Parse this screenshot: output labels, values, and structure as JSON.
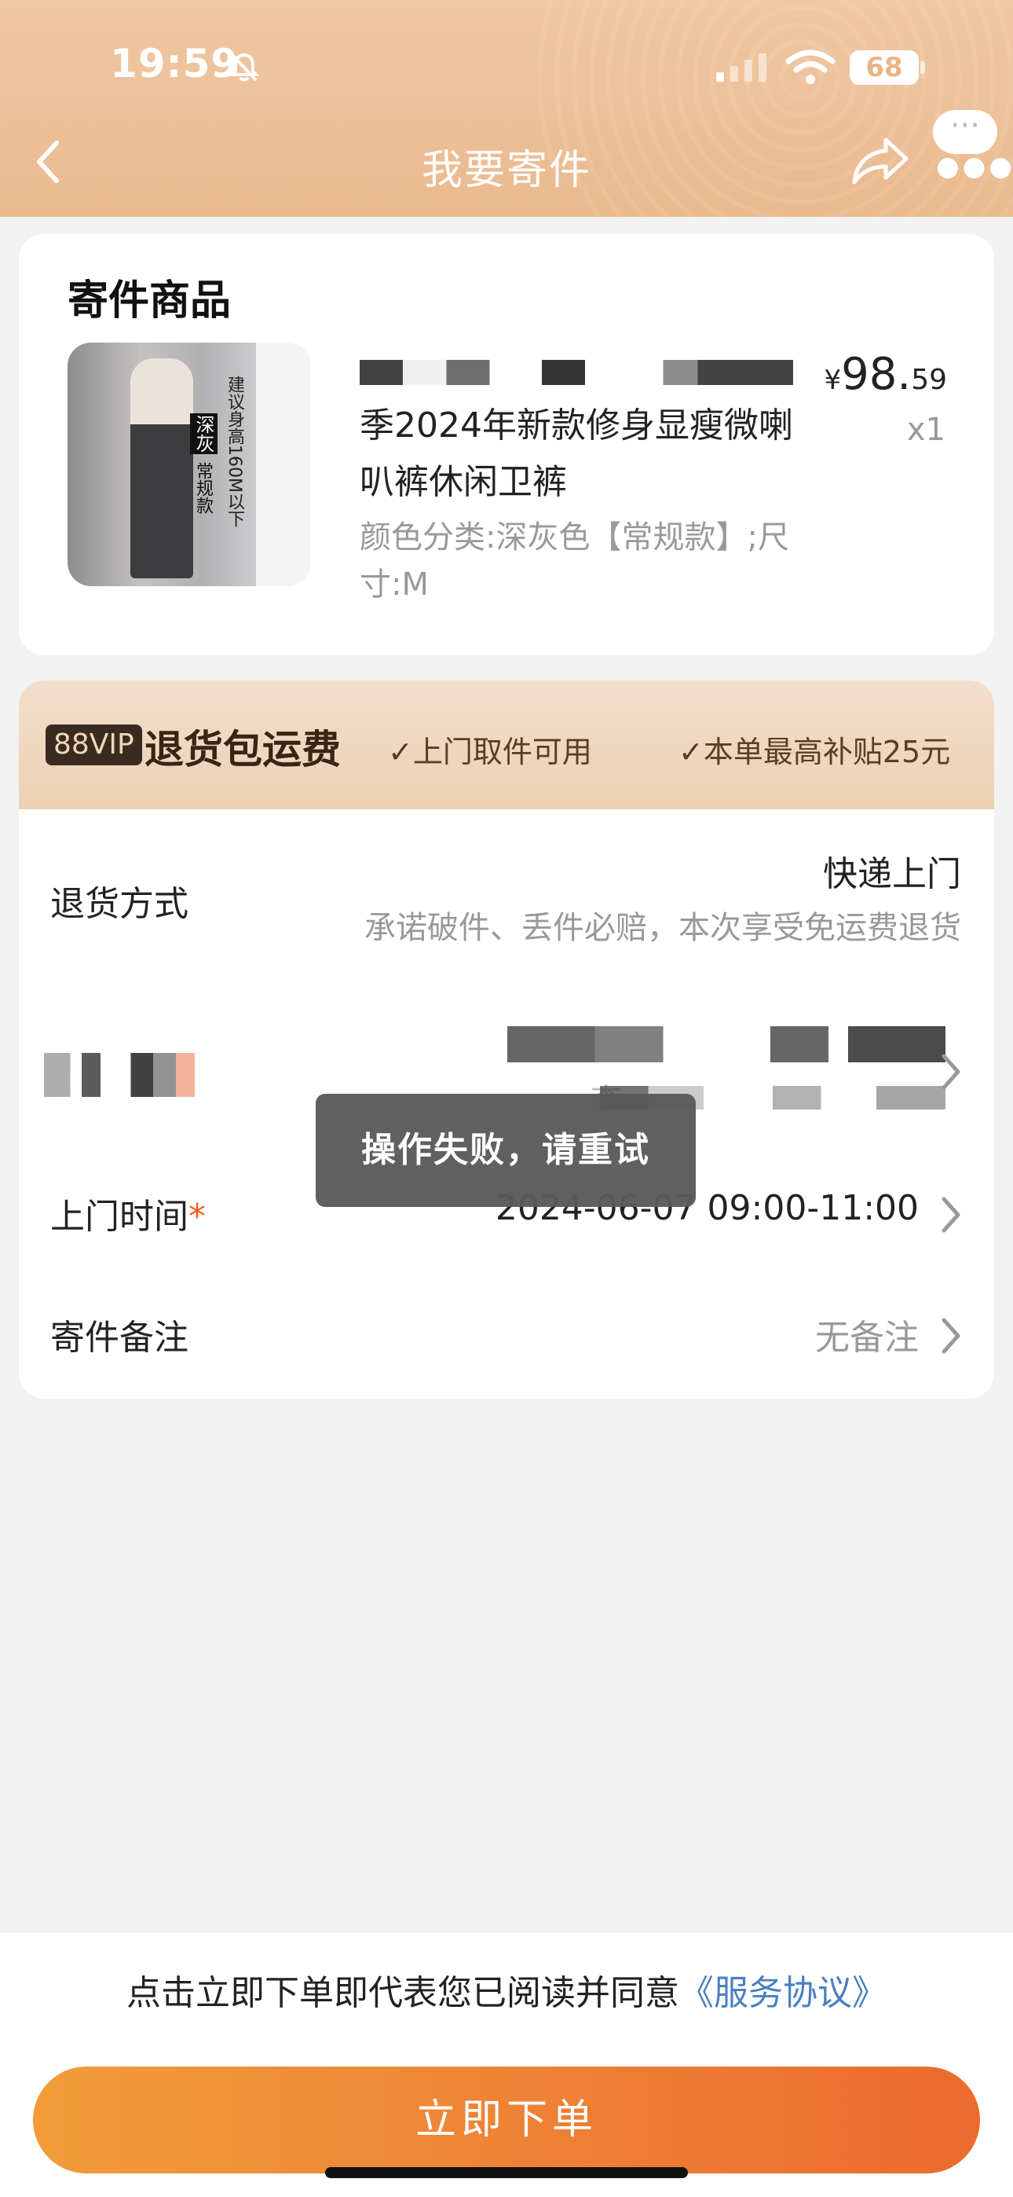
{
  "status_bar": {
    "time": "19:59",
    "battery": "68",
    "icons": [
      "bell-muted-icon",
      "signal-icon",
      "wifi-icon",
      "battery-icon"
    ]
  },
  "nav": {
    "title": "我要寄件",
    "icons": [
      "back-icon",
      "share-icon",
      "more-icon"
    ],
    "more_label": "···"
  },
  "goods": {
    "section_title": "寄件商品",
    "name": "季2024年新款修身显瘦微喇叭裤休闲卫裤",
    "spec": "颜色分类:深灰色【常规款】;尺寸:M",
    "price_symbol": "¥",
    "price_int": "98.",
    "price_dec": "59",
    "quantity": "x1",
    "thumb_text_a": "建议身高160M以下",
    "thumb_text_b": "深灰",
    "thumb_text_c": "常规款"
  },
  "vip": {
    "badge": "88VIP",
    "title": "退货包运费",
    "perk1": "✓上门取件可用",
    "perk2": "✓本单最高补贴25元"
  },
  "return_method": {
    "label": "退货方式",
    "value": "快递上门",
    "desc": "承诺破件、丢件必赔，本次享受免运费退货"
  },
  "address": {
    "partial_char": "李"
  },
  "pickup_time": {
    "label": "上门时间",
    "required_mark": "*",
    "value": "2024-06-07 09:00-11:00"
  },
  "remark": {
    "label": "寄件备注",
    "value": "无备注"
  },
  "toast": {
    "message": "操作失败，请重试"
  },
  "footer": {
    "agreement_text": "点击立即下单即代表您已阅读并同意",
    "agreement_link": "《服务协议》",
    "submit_label": "立即下单"
  },
  "colors": {
    "header": "#eab98e",
    "accent": "#ec6a2e",
    "link": "#4a7fc1"
  }
}
